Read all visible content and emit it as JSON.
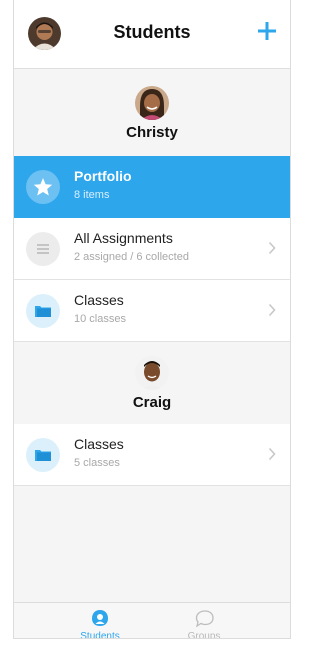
{
  "header": {
    "title": "Students",
    "avatar_icon": "user-photo-icon",
    "add_icon": "plus-icon"
  },
  "students": [
    {
      "name": "Christy",
      "items": [
        {
          "title": "Portfolio",
          "subtitle": "8 items",
          "icon": "star-icon",
          "selected": true
        },
        {
          "title": "All Assignments",
          "subtitle": "2 assigned / 6 collected",
          "icon": "list-icon",
          "selected": false
        },
        {
          "title": "Classes",
          "subtitle": "10 classes",
          "icon": "folder-icon",
          "selected": false
        }
      ]
    },
    {
      "name": "Craig",
      "items": [
        {
          "title": "Classes",
          "subtitle": "5 classes",
          "icon": "folder-icon",
          "selected": false
        }
      ]
    }
  ],
  "tabbar": {
    "tabs": [
      {
        "label": "Students",
        "icon": "student-icon",
        "active": true
      },
      {
        "label": "Groups",
        "icon": "groups-icon",
        "active": false
      }
    ]
  },
  "colors": {
    "accent": "#2ea6ec",
    "icon_bg": "#dcf0fc",
    "muted": "#a8a8a8"
  }
}
